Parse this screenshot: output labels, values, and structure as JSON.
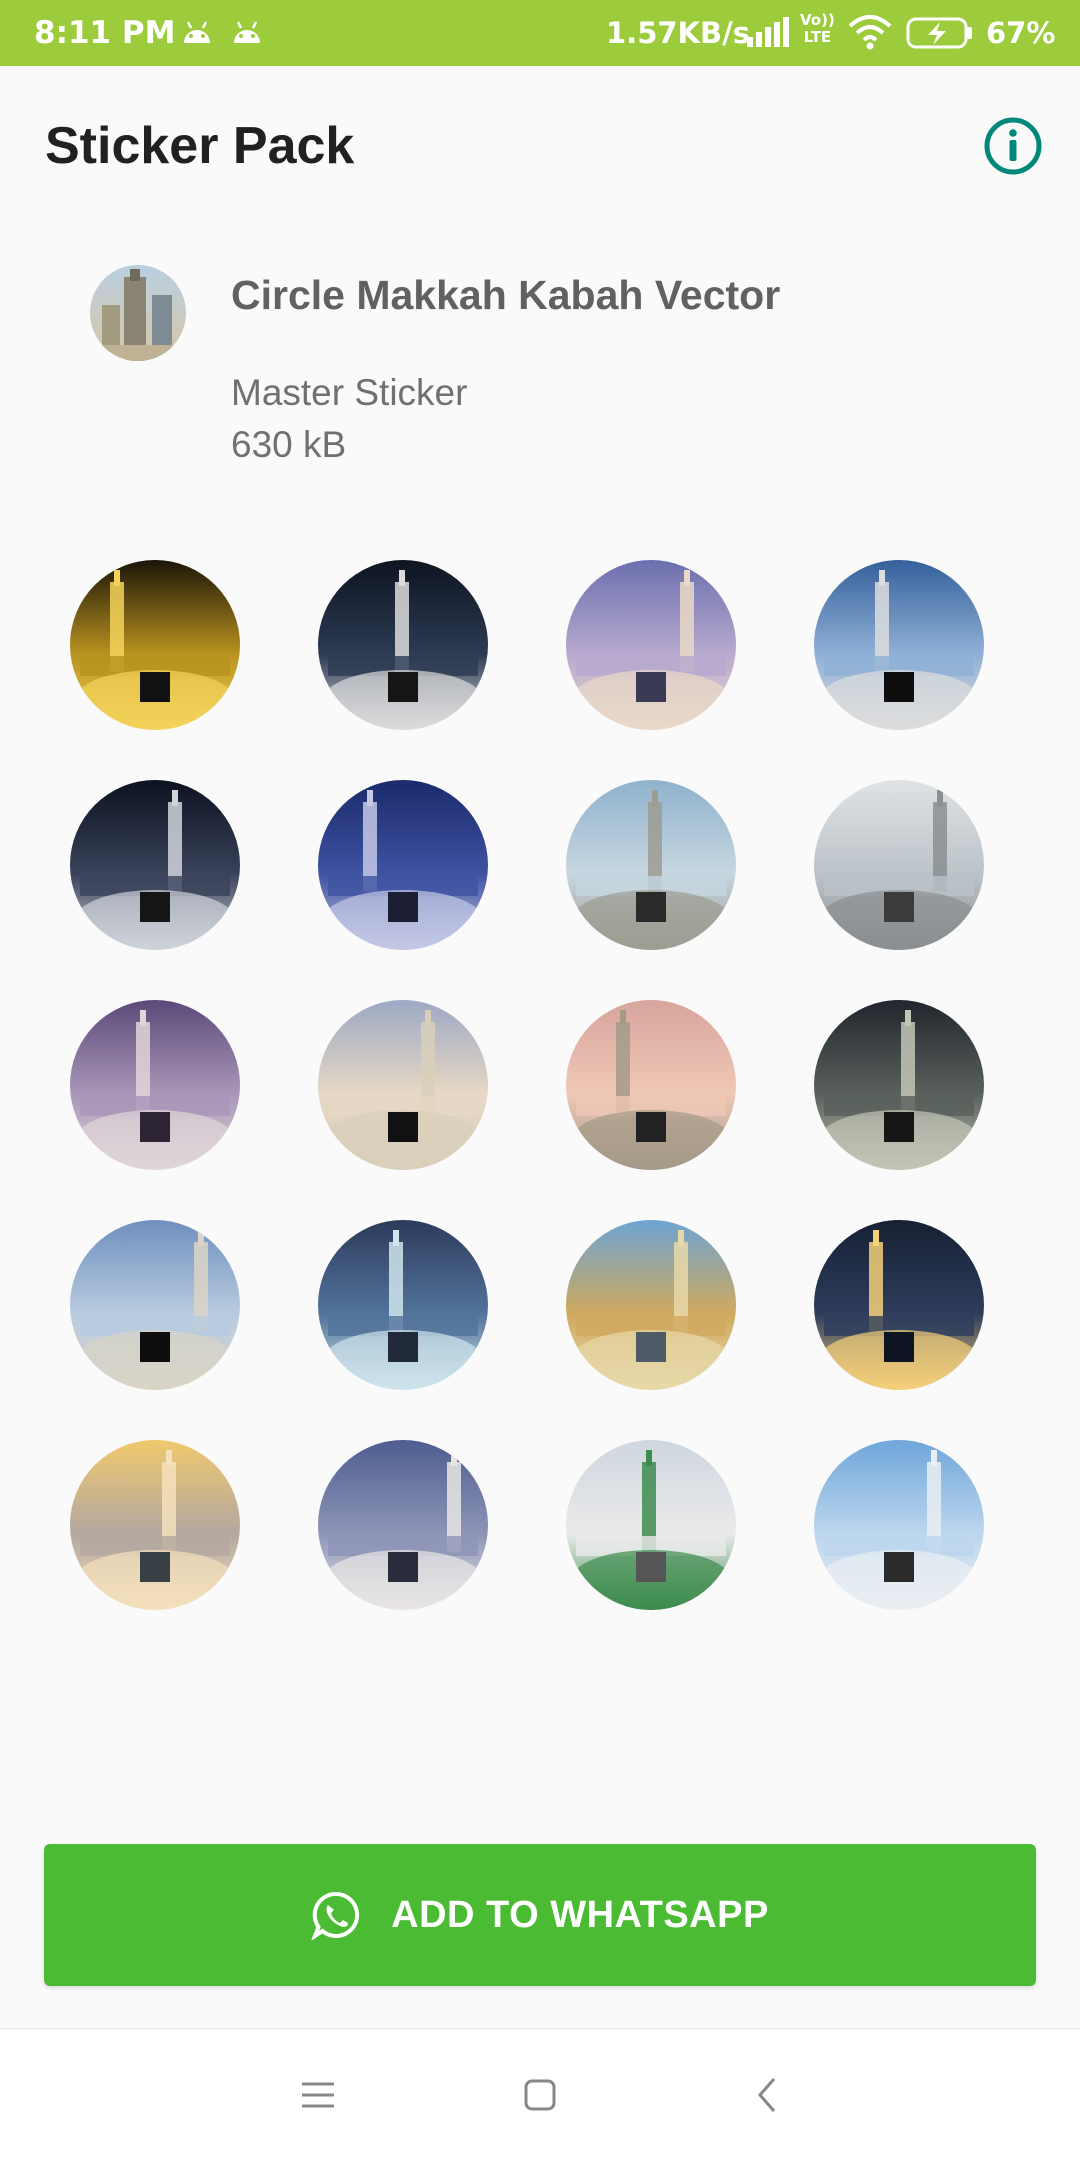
{
  "status_bar": {
    "time": "8:11 PM",
    "net_speed": "1.57KB/s",
    "volte_top": "Vo))",
    "volte_bottom": "LTE",
    "battery": "67%"
  },
  "app_bar": {
    "title": "Sticker Pack",
    "info_icon": "info-icon"
  },
  "pack": {
    "name": "Circle Makkah Kabah Vector",
    "publisher": "Master Sticker",
    "size": "630 kB"
  },
  "stickers": [
    {
      "icon": "kaaba-night-sticker"
    },
    {
      "icon": "kaaba-minarets-sticker"
    },
    {
      "icon": "clock-tower-sticker"
    },
    {
      "icon": "kaaba-closeup-sticker"
    },
    {
      "icon": "haram-aerial-sticker"
    },
    {
      "icon": "towers-night-sticker"
    },
    {
      "icon": "clock-tower-day-sticker"
    },
    {
      "icon": "umbrellas-sticker"
    },
    {
      "icon": "haram-dusk-sticker"
    },
    {
      "icon": "kaaba-courtyard-sticker"
    },
    {
      "icon": "clock-tower-sunset-sticker"
    },
    {
      "icon": "haram-top-view-sticker"
    },
    {
      "icon": "kaaba-crowd-sticker"
    },
    {
      "icon": "mosque-evening-sticker"
    },
    {
      "icon": "tower-upward-sticker"
    },
    {
      "icon": "makkah-city-night-sticker"
    },
    {
      "icon": "nabawi-sunset-sticker"
    },
    {
      "icon": "nabawi-aerial-sticker"
    },
    {
      "icon": "green-dome-sticker"
    },
    {
      "icon": "nabawi-plaza-sticker"
    }
  ],
  "add_button": {
    "label": "ADD TO WHATSAPP",
    "icon": "whatsapp-icon"
  },
  "nav_bar": {
    "items": [
      "menu-icon",
      "home-icon",
      "back-icon"
    ]
  },
  "colors": {
    "status_bar": "#9ccb3b",
    "accent": "#009688",
    "button": "#4cbb34"
  }
}
